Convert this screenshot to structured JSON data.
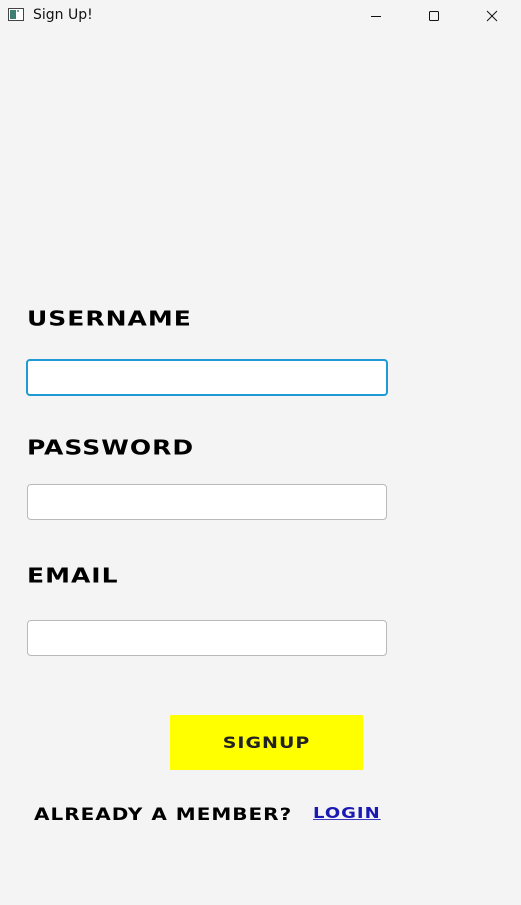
{
  "window": {
    "title": "Sign Up!",
    "icon": "app-window-icon",
    "controls": [
      "minimize-icon",
      "maximize-icon",
      "close-icon"
    ]
  },
  "form": {
    "username_label": "USERNAME",
    "username_value": "",
    "password_label": "PASSWORD",
    "password_value": "",
    "email_label": "EMAIL",
    "email_value": "",
    "signup_label": "SIGNUP",
    "signup_color": "#ffff00"
  },
  "footer": {
    "prompt": "ALREADY A MEMBER?",
    "login_link": "LOGIN",
    "link_color": "#1a1ab3"
  },
  "colors": {
    "background": "#f4f4f4",
    "focus_border": "#1e9ad6"
  }
}
